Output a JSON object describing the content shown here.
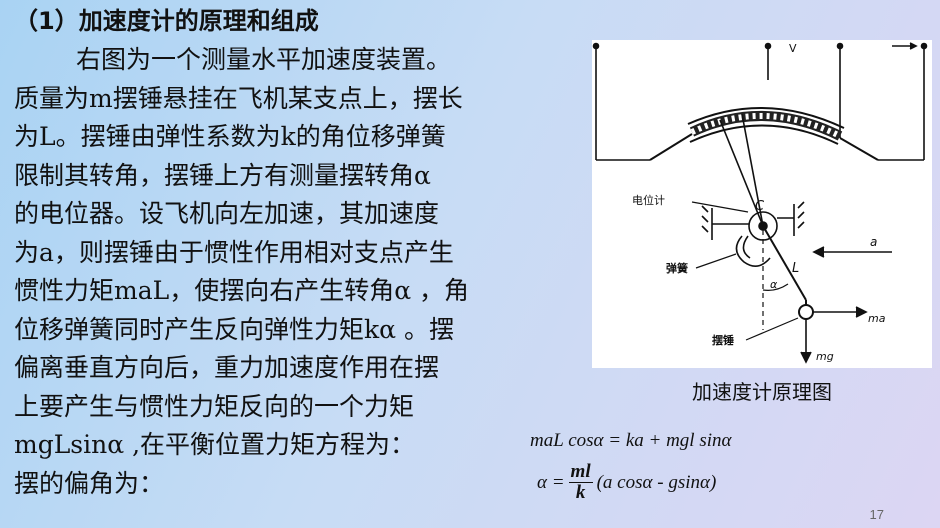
{
  "slide": {
    "heading": "（1）加速度计的原理和组成",
    "body_lines": [
      "右图为一个测量水平加速度装置。",
      "质量为m摆锤悬挂在飞机某支点上，摆长",
      "为L。摆锤由弹性系数为k的角位移弹簧",
      "限制其转角，摆锤上方有测量摆转角α",
      "的电位器。设飞机向左加速，其加速度",
      "为a，则摆锤由于惯性作用相对支点产生",
      "惯性力矩maL，使摆向右产生转角α ，角",
      "位移弹簧同时产生反向弹性力矩kα 。摆",
      "偏离垂直方向后，重力加速度作用在摆",
      "上要产生与惯性力矩反向的一个力矩",
      "mgLsinα ,在平衡位置力矩方程为：",
      "摆的偏角为："
    ],
    "equation_1": "maL cosα = ka + mgl sinα",
    "equation_2": {
      "lhs": "α =",
      "numerator": "ml",
      "denominator": "k",
      "rhs": "(a cosα - gsinα)"
    },
    "figure_caption": "加速度计原理图",
    "figure_labels": {
      "voltage": "V",
      "potentiometer": "电位计",
      "spring": "弹簧",
      "pendulum": "摆锤",
      "pivot": "C",
      "length": "L",
      "acceleration": "a",
      "angle": "α",
      "inertial_force": "ma",
      "gravity_force": "mg"
    },
    "page_number": "17"
  }
}
